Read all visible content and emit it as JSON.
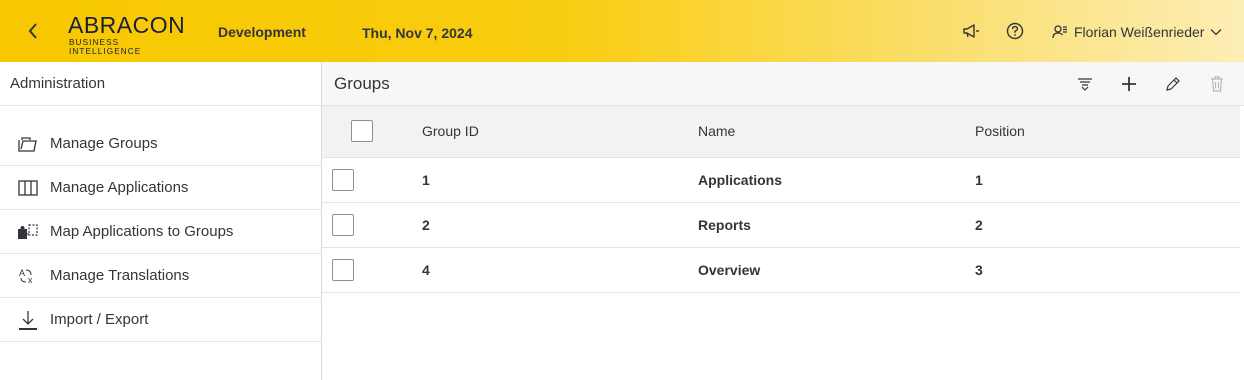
{
  "header": {
    "logo_text": "ABRACON",
    "logo_sub": "BUSINESS INTELLIGENCE",
    "environment": "Development",
    "date": "Thu, Nov 7, 2024",
    "user_name": "Florian Weißenrieder",
    "accent_color": "#f7c800"
  },
  "sidebar": {
    "title": "Administration",
    "items": [
      {
        "label": "Manage Groups",
        "icon": "folder-icon"
      },
      {
        "label": "Manage Applications",
        "icon": "columns-icon"
      },
      {
        "label": "Map Applications to Groups",
        "icon": "puzzle-icon"
      },
      {
        "label": "Manage Translations",
        "icon": "translate-icon"
      },
      {
        "label": "Import / Export",
        "icon": "download-icon"
      }
    ]
  },
  "main": {
    "title": "Groups",
    "columns": [
      "Group ID",
      "Name",
      "Position"
    ],
    "rows": [
      {
        "id": "1",
        "name": "Applications",
        "position": "1"
      },
      {
        "id": "2",
        "name": "Reports",
        "position": "2"
      },
      {
        "id": "4",
        "name": "Overview",
        "position": "3"
      }
    ]
  }
}
